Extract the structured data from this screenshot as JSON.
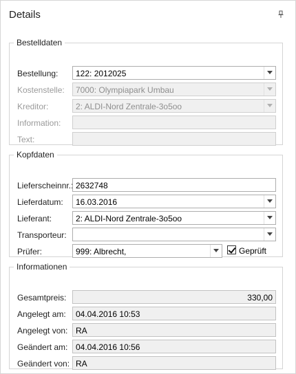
{
  "panel": {
    "title": "Details"
  },
  "bestelldaten": {
    "legend": "Bestelldaten",
    "bestellung": {
      "label": "Bestellung:",
      "value": "122: 2012025"
    },
    "kostenstelle": {
      "label": "Kostenstelle:",
      "value": "7000: Olympiapark Umbau"
    },
    "kreditor": {
      "label": "Kreditor:",
      "value": "2: ALDI-Nord Zentrale-3o5oo"
    },
    "information": {
      "label": "Information:",
      "value": ""
    },
    "text": {
      "label": "Text:",
      "value": ""
    }
  },
  "kopfdaten": {
    "legend": "Kopfdaten",
    "lieferscheinnr": {
      "label": "Lieferscheinnr.:",
      "value": "2632748"
    },
    "lieferdatum": {
      "label": "Lieferdatum:",
      "value": "16.03.2016"
    },
    "lieferant": {
      "label": "Lieferant:",
      "value": "2: ALDI-Nord Zentrale-3o5oo"
    },
    "transporteur": {
      "label": "Transporteur:",
      "value": ""
    },
    "pruefer": {
      "label": "Prüfer:",
      "value": "999: Albrecht,"
    },
    "geprueft": {
      "label": "Geprüft",
      "checked": true
    }
  },
  "informationen": {
    "legend": "Informationen",
    "gesamtpreis": {
      "label": "Gesamtpreis:",
      "value": "330,00"
    },
    "angelegt_am": {
      "label": "Angelegt am:",
      "value": "04.04.2016 10:53"
    },
    "angelegt_von": {
      "label": "Angelegt von:",
      "value": "RA"
    },
    "geaendert_am": {
      "label": "Geändert am:",
      "value": "04.04.2016 10:56"
    },
    "geaendert_von": {
      "label": "Geändert von:",
      "value": "RA"
    }
  },
  "icons": {
    "pin": "pin-icon",
    "dropdown": "chevron-down-icon",
    "check": "checkmark-icon"
  }
}
